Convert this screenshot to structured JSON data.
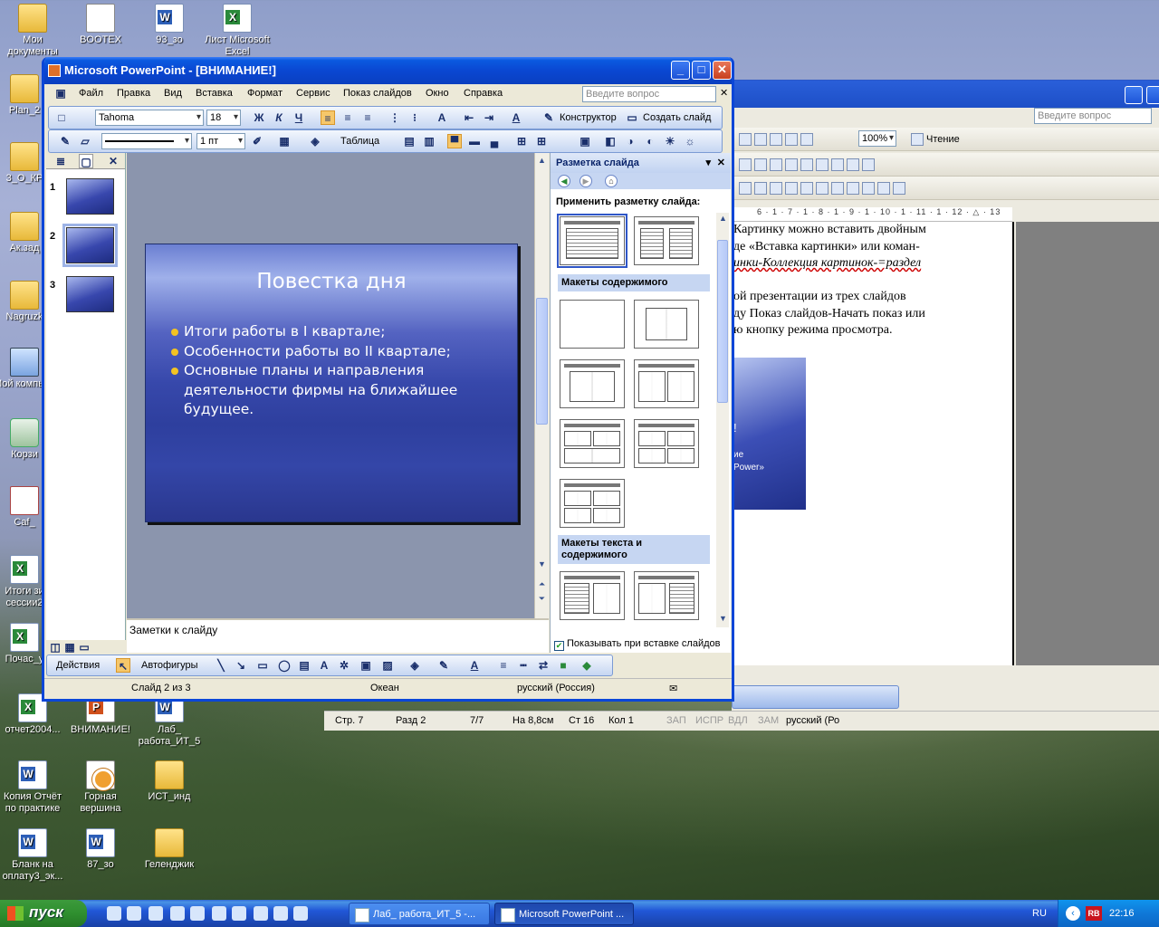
{
  "desktop": {
    "icons": [
      {
        "label": "Мои документы",
        "kind": "folder"
      },
      {
        "label": "BOOTEX",
        "kind": "doc"
      },
      {
        "label": "93_зо",
        "kind": "word"
      },
      {
        "label": "Лист Microsoft Excel",
        "kind": "excel"
      },
      {
        "label": "Plan_2",
        "kind": "folder"
      },
      {
        "label": "3_О_КР",
        "kind": "folder"
      },
      {
        "label": "Ак.зад",
        "kind": "folder"
      },
      {
        "label": "Nagruzk",
        "kind": "folder"
      },
      {
        "label": "Мой компьют",
        "kind": "pc"
      },
      {
        "label": "Корзи",
        "kind": "bin"
      },
      {
        "label": "Caf_",
        "kind": "pdf"
      },
      {
        "label": "Итоги зи сессии2",
        "kind": "excel"
      },
      {
        "label": "Почас_у",
        "kind": "excel"
      },
      {
        "label": "отчет2004...",
        "kind": "excel"
      },
      {
        "label": "ВНИМАНИЕ!",
        "kind": "ppt"
      },
      {
        "label": "Лаб_ работа_ИТ_5",
        "kind": "word"
      },
      {
        "label": "Копия Отчёт по практике",
        "kind": "word"
      },
      {
        "label": "Горная вершина",
        "kind": "jpg"
      },
      {
        "label": "ИСТ_инд",
        "kind": "folder"
      },
      {
        "label": "Бланк на оплату3_эк...",
        "kind": "word"
      },
      {
        "label": "87_зо",
        "kind": "word"
      },
      {
        "label": "Геленджик",
        "kind": "folder"
      }
    ]
  },
  "ppt": {
    "title": "Microsoft PowerPoint - [ВНИМАНИЕ!]",
    "menu": [
      "Файл",
      "Правка",
      "Вид",
      "Вставка",
      "Формат",
      "Сервис",
      "Показ слайдов",
      "Окно",
      "Справка"
    ],
    "ask_placeholder": "Введите вопрос",
    "font_name": "Tahoma",
    "font_size": "18",
    "constructor_label": "Конструктор",
    "create_slide_label": "Создать слайд",
    "line_width": "1 пт",
    "table_label": "Таблица",
    "slide_numbers": [
      "1",
      "2",
      "3"
    ],
    "slide": {
      "title": "Повестка дня",
      "bullets": [
        "Итоги работы в I квартале;",
        "Особенности работы во II квартале;",
        "Основные планы и направления деятельности фирмы на ближайшее будущее."
      ]
    },
    "notes_placeholder": "Заметки к слайду",
    "taskpane": {
      "title": "Разметка слайда",
      "apply_label": "Применить разметку слайда:",
      "section_content": "Макеты содержимого",
      "section_text_content": "Макеты текста и содержимого",
      "show_on_insert": "Показывать при вставке слайдов"
    },
    "drawing": {
      "actions": "Действия",
      "autoshapes": "Автофигуры"
    },
    "status": {
      "slide": "Слайд 2 из 3",
      "design": "Океан",
      "language": "русский (Россия)"
    }
  },
  "word": {
    "ask_placeholder": "Введите вопрос",
    "zoom": "100%",
    "reading": "Чтение",
    "ruler": "6 · 1 · 7 · 1 · 8 · 1 · 9 · 1 · 10 · 1 · 11 · 1 · 12 · △ · 13",
    "lines": [
      "Картинку можно вставить двойным",
      "де «Вставка картинки» или коман-",
      "инки-Коллекция картинок-=раздел",
      "",
      "ой презентации из трех слайдов",
      "ду Показ слайдов-Начать показ или",
      "ю кнопку режима просмотра."
    ],
    "thumb_lines": [
      "!",
      "ие",
      "Power»"
    ],
    "status": [
      "Стр. 7",
      "Разд 2",
      "7/7",
      "На 8,8см",
      "Ст 16",
      "Кол 1",
      "ЗАП",
      "ИСПР",
      "ВДЛ",
      "ЗАМ",
      "русский (Ро"
    ]
  },
  "taskbar": {
    "start": "пуск",
    "tasks": [
      "Лаб_ работа_ИТ_5 -...",
      "Microsoft PowerPoint ..."
    ],
    "lang": "RU",
    "time": "22:16"
  }
}
